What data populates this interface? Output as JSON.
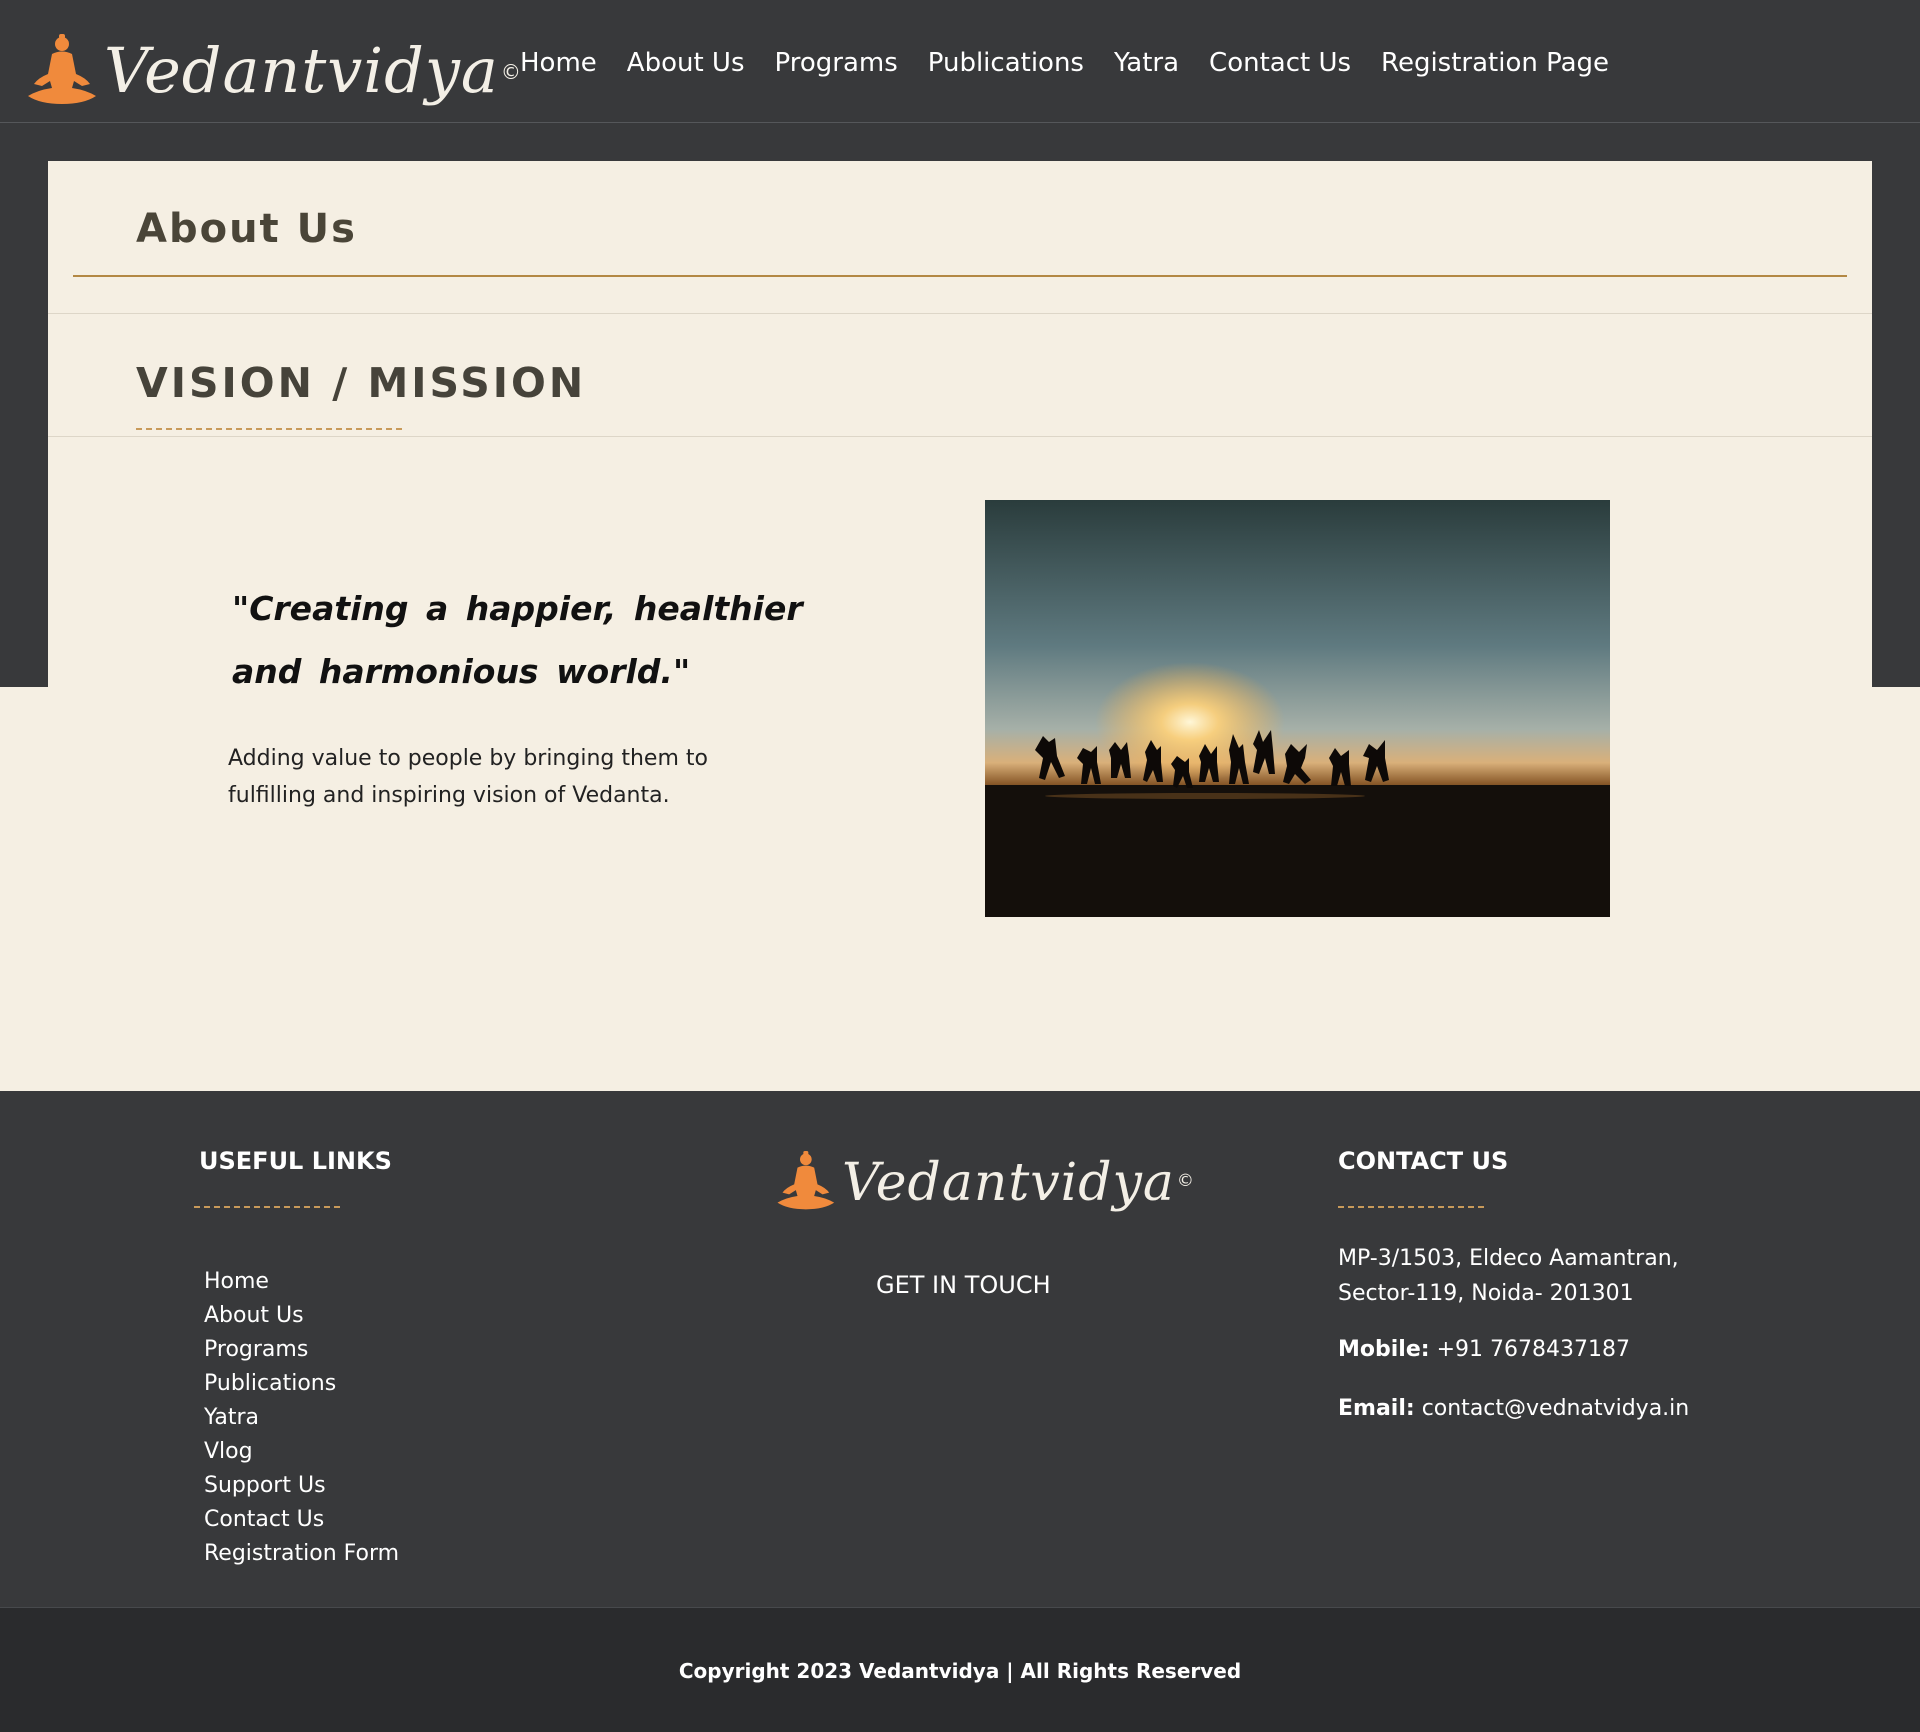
{
  "brand": {
    "name": "Vedantvidya",
    "reg_mark": "©",
    "icon": "meditating-figure-icon",
    "accent": "#f08a3c"
  },
  "nav": {
    "items": [
      "Home",
      "About Us",
      "Programs",
      "Publications",
      "Yatra",
      "Contact Us",
      "Registration Page"
    ]
  },
  "page": {
    "title": "About Us",
    "section_title": "VISION / MISSION",
    "quote": "\"Creating a happier, healthier and harmonious world.\"",
    "mission": "Adding value to people by bringing them to fulfilling and inspiring vision of Vedanta.",
    "image_subject": "silhouettes-jumping-at-sunset"
  },
  "footer": {
    "useful_links_title": "USEFUL LINKS",
    "links": [
      "Home",
      "About Us",
      "Programs",
      "Publications",
      "Yatra",
      "Vlog",
      "Support Us",
      "Contact Us",
      "Registration Form"
    ],
    "get_in_touch": "GET IN TOUCH",
    "contact_title": "CONTACT US",
    "address": "MP-3/1503, Eldeco Aamantran, Sector-119, Noida- 201301",
    "mobile_label": "Mobile:",
    "mobile": "+91 7678437187",
    "email_label": "Email:",
    "email": "contact@vednatvidya.in",
    "copyright": "Copyright 2023 Vedantvidya | All Rights Reserved"
  },
  "colors": {
    "dark": "#38393b",
    "cream": "#f5efe3",
    "gold": "#b38844",
    "footer_bottom": "#2a2b2d"
  }
}
